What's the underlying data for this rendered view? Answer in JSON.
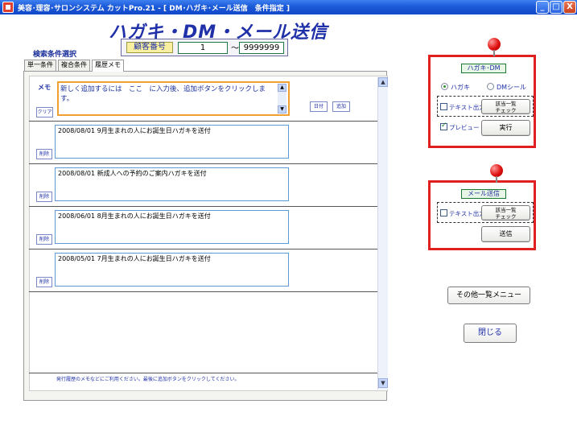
{
  "window": {
    "title": "美容･理容･サロンシステム カットPro.21 - [ DM･ハガキ･メール送信　条件指定 ]",
    "minimize": "_",
    "maximize": "□",
    "close": "X"
  },
  "heading": "ハガキ・DM・メール送信",
  "search": {
    "label": "検索条件選択",
    "customer_label": "顧客番号",
    "from": "1",
    "tilde": "～",
    "to": "9999999"
  },
  "tabs": [
    "単一条件",
    "複合条件",
    "履歴メモ"
  ],
  "memo": {
    "label": "メモ",
    "input_text": "新しく追加するには　ここ　に入力後、追加ボタンをクリックします。",
    "clear_label": "クリア",
    "date_label": "日付",
    "add_label": "追加"
  },
  "history": [
    {
      "text": "2008/08/01  9月生まれの人にお誕生日ハガキを送付",
      "delete_label": "削除"
    },
    {
      "text": "2008/08/01  新成人への予約のご案内ハガキを送付",
      "delete_label": "削除"
    },
    {
      "text": "2008/06/01  8月生まれの人にお誕生日ハガキを送付",
      "delete_label": "削除"
    },
    {
      "text": "2008/05/01  7月生まれの人にお誕生日ハガキを送付",
      "delete_label": "削除"
    }
  ],
  "footer_note": "発行履歴のメモなどにご利用ください。最後に追加ボタンをクリックしてください。",
  "postcard_panel": {
    "legend": "ハガキ･DM",
    "radio_postcard": "ハガキ",
    "radio_dm": "DMシール",
    "text_output": "テキスト出力",
    "list_check": [
      "該当一覧",
      "チェック"
    ],
    "preview": "プレビュー",
    "execute": "実行"
  },
  "mail_panel": {
    "legend": "メール送信",
    "text_output": "テキスト出力",
    "list_check": [
      "該当一覧",
      "チェック"
    ],
    "send": "送信"
  },
  "other_menu": "その他一覧メニュー",
  "close_button": "閉じる",
  "scroll_up": "▲",
  "scroll_down": "▼"
}
